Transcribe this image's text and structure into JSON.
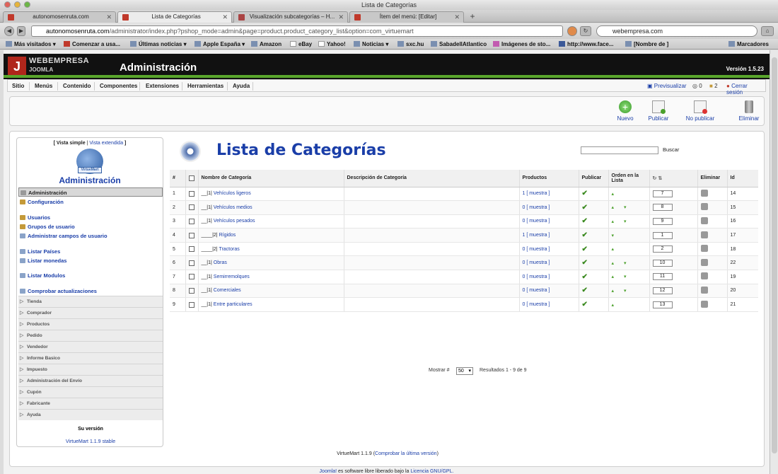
{
  "window": {
    "title": "Lista de Categorías"
  },
  "tabs": [
    {
      "label": "autonomosenruta.com"
    },
    {
      "label": "Lista de Categorías"
    },
    {
      "label": "Visualización subcategorías – H..."
    },
    {
      "label": "Ítem del menú: [Editar]"
    }
  ],
  "nav": {
    "url_host": "autonomosenruta.com",
    "url_path": "/administrator/index.php?pshop_mode=admin&page=product.product_category_list&option=com_virtuemart",
    "search_value": "webempresa.com"
  },
  "bookmarks": [
    "Más visitados ▾",
    "Comenzar a usa...",
    "Últimas noticias ▾",
    "Apple España ▾",
    "Amazon",
    "eBay",
    "Yahoo!",
    "Noticias ▾",
    "sxc.hu",
    "SabadellAtlantico",
    "Imágenes de sto...",
    "http://www.face...",
    "[Nombre de ]",
    "Marcadores"
  ],
  "header": {
    "brand": "WEBEMPRESA",
    "brand_sub": "JOOMLA",
    "title": "Administración",
    "version": "Versión 1.5.23"
  },
  "menu": {
    "items": [
      "Sitio",
      "Menús",
      "Contenido",
      "Componentes",
      "Extensiones",
      "Herramientas",
      "Ayuda"
    ],
    "preview": "Previsualizar",
    "messages": "0",
    "users": "2",
    "logout": "Cerrar sesión"
  },
  "toolbar": {
    "new": "Nuevo",
    "publish": "Publicar",
    "unpublish": "No publicar",
    "delete": "Eliminar"
  },
  "sidebar": {
    "view_simple": "[ Vista simple",
    "view_sep": "|",
    "view_extended": "Vista extendida",
    "view_end": "]",
    "logo_text": "VirtueMart",
    "title": "Administración",
    "items": [
      "Administración",
      "Configuración",
      "Usuarios",
      "Grupos de usuario",
      "Administrar campos de usuario",
      "Listar Países",
      "Listar monedas",
      "Listar Modulos",
      "Comprobar actualizaciones"
    ],
    "sections": [
      "Tienda",
      "Comprador",
      "Productos",
      "Pedido",
      "Vendedor",
      "Informe Basico",
      "Impuesto",
      "Administración del Envío",
      "Cupón",
      "Fabricante",
      "Ayuda"
    ],
    "your_version": "Su versión",
    "version": "VirtueMart 1.1.9 stable"
  },
  "content": {
    "title": "Lista de Categorías",
    "search_button": "Buscar"
  },
  "table": {
    "headers": [
      "#",
      "",
      "Nombre de Categoría",
      "Descripción de Categoría",
      "Productos",
      "Publicar",
      "Orden en la Lista",
      "",
      "Eliminar",
      "Id"
    ],
    "rows": [
      {
        "n": "1",
        "prefix": "__|1|",
        "name": "Vehículos ligeros",
        "products": "1 [ muestra ]",
        "arrows": "▴",
        "order": "7",
        "id": "14"
      },
      {
        "n": "2",
        "prefix": "__|1|",
        "name": "Vehículos medios",
        "products": "0 [ muestra ]",
        "arrows": "▴ ▾",
        "order": "8",
        "id": "15"
      },
      {
        "n": "3",
        "prefix": "__|1|",
        "name": "Vehículos pesados",
        "products": "0 [ muestra ]",
        "arrows": "▴ ▾",
        "order": "9",
        "id": "16"
      },
      {
        "n": "4",
        "prefix": "____|2|",
        "name": "Rígidos",
        "products": "1 [ muestra ]",
        "arrows": "▾",
        "order": "1",
        "id": "17"
      },
      {
        "n": "5",
        "prefix": "____|2|",
        "name": "Tractoras",
        "products": "0 [ muestra ]",
        "arrows": "▴",
        "order": "2",
        "id": "18"
      },
      {
        "n": "6",
        "prefix": "__|1|",
        "name": "Obras",
        "products": "0 [ muestra ]",
        "arrows": "▴ ▾",
        "order": "10",
        "id": "22"
      },
      {
        "n": "7",
        "prefix": "__|1|",
        "name": "Semirremolques",
        "products": "0 [ muestra ]",
        "arrows": "▴ ▾",
        "order": "11",
        "id": "19"
      },
      {
        "n": "8",
        "prefix": "__|1|",
        "name": "Comerciales",
        "products": "0 [ muestra ]",
        "arrows": "▴ ▾",
        "order": "12",
        "id": "20"
      },
      {
        "n": "9",
        "prefix": "__|1|",
        "name": "Entre particulares",
        "products": "0 [ muestra ]",
        "arrows": "▴",
        "order": "13",
        "id": "21"
      }
    ]
  },
  "pager": {
    "show_label": "Mostrar #",
    "per_page": "50",
    "results": "Resultados 1 - 9 de 9"
  },
  "footer": {
    "vm_version": "VirtueMart 1.1.9",
    "vm_link": "Comprobar la última versión",
    "joomla": "Joomla!",
    "joomla_text": "es software libre liberado bajo la",
    "license": "Licencia GNU/GPL."
  },
  "colors": {
    "accent": "#1a3ea8",
    "header_bg": "#111111",
    "green": "#5aa62c",
    "brand_red": "#b0261b"
  }
}
